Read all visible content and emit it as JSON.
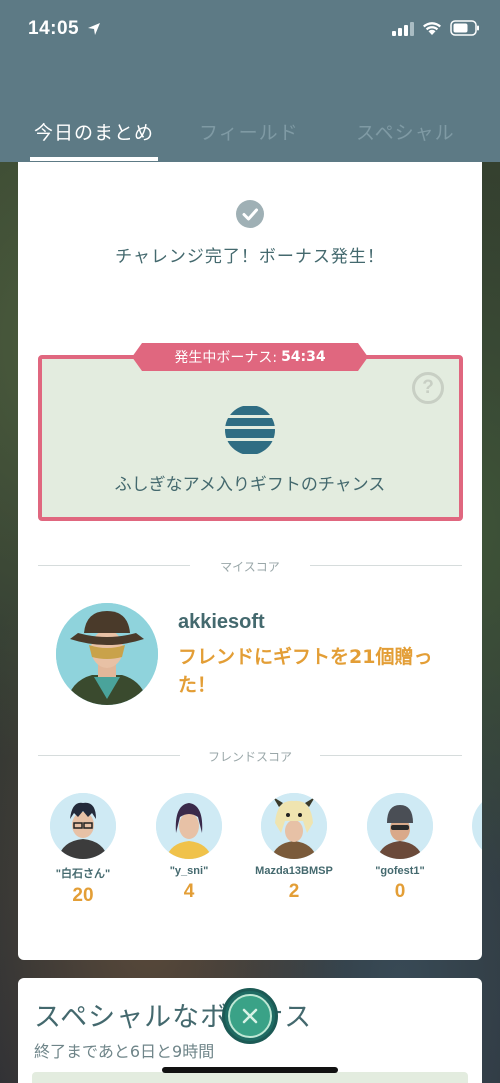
{
  "status_bar": {
    "time": "14:05"
  },
  "tabs": [
    {
      "label": "今日のまとめ",
      "active": true
    },
    {
      "label": "フィールド",
      "active": false
    },
    {
      "label": "スペシャル",
      "active": false
    }
  ],
  "summary": {
    "challenge_text": "チャレンジ完了！ボーナス発生！",
    "bonus_ribbon_label": "発生中ボーナス:",
    "bonus_timer": "54:34",
    "help_symbol": "?",
    "bonus_description": "ふしぎなアメ入りギフトのチャンス",
    "bonus_icon": "rare-candy-icon"
  },
  "my_score": {
    "section_title": "マイスコア",
    "username": "akkiesoft",
    "score_text": "フレンドにギフトを21個贈った！"
  },
  "friend_score": {
    "section_title": "フレンドスコア",
    "friends": [
      {
        "name": "\"白石さん\"",
        "score": "20"
      },
      {
        "name": "\"y_sni\"",
        "score": "4"
      },
      {
        "name": "Mazda13BMSP",
        "score": "2"
      },
      {
        "name": "\"gofest1\"",
        "score": "0"
      }
    ]
  },
  "special_card": {
    "title": "スペシャルなボーナス",
    "subtitle": "終了まであと6日と9時間"
  },
  "colors": {
    "header": "#5d7a85",
    "accent_pink": "#e0677f",
    "score_orange": "#e39e36",
    "text_teal": "#44696e",
    "close_green": "#3aa287"
  }
}
